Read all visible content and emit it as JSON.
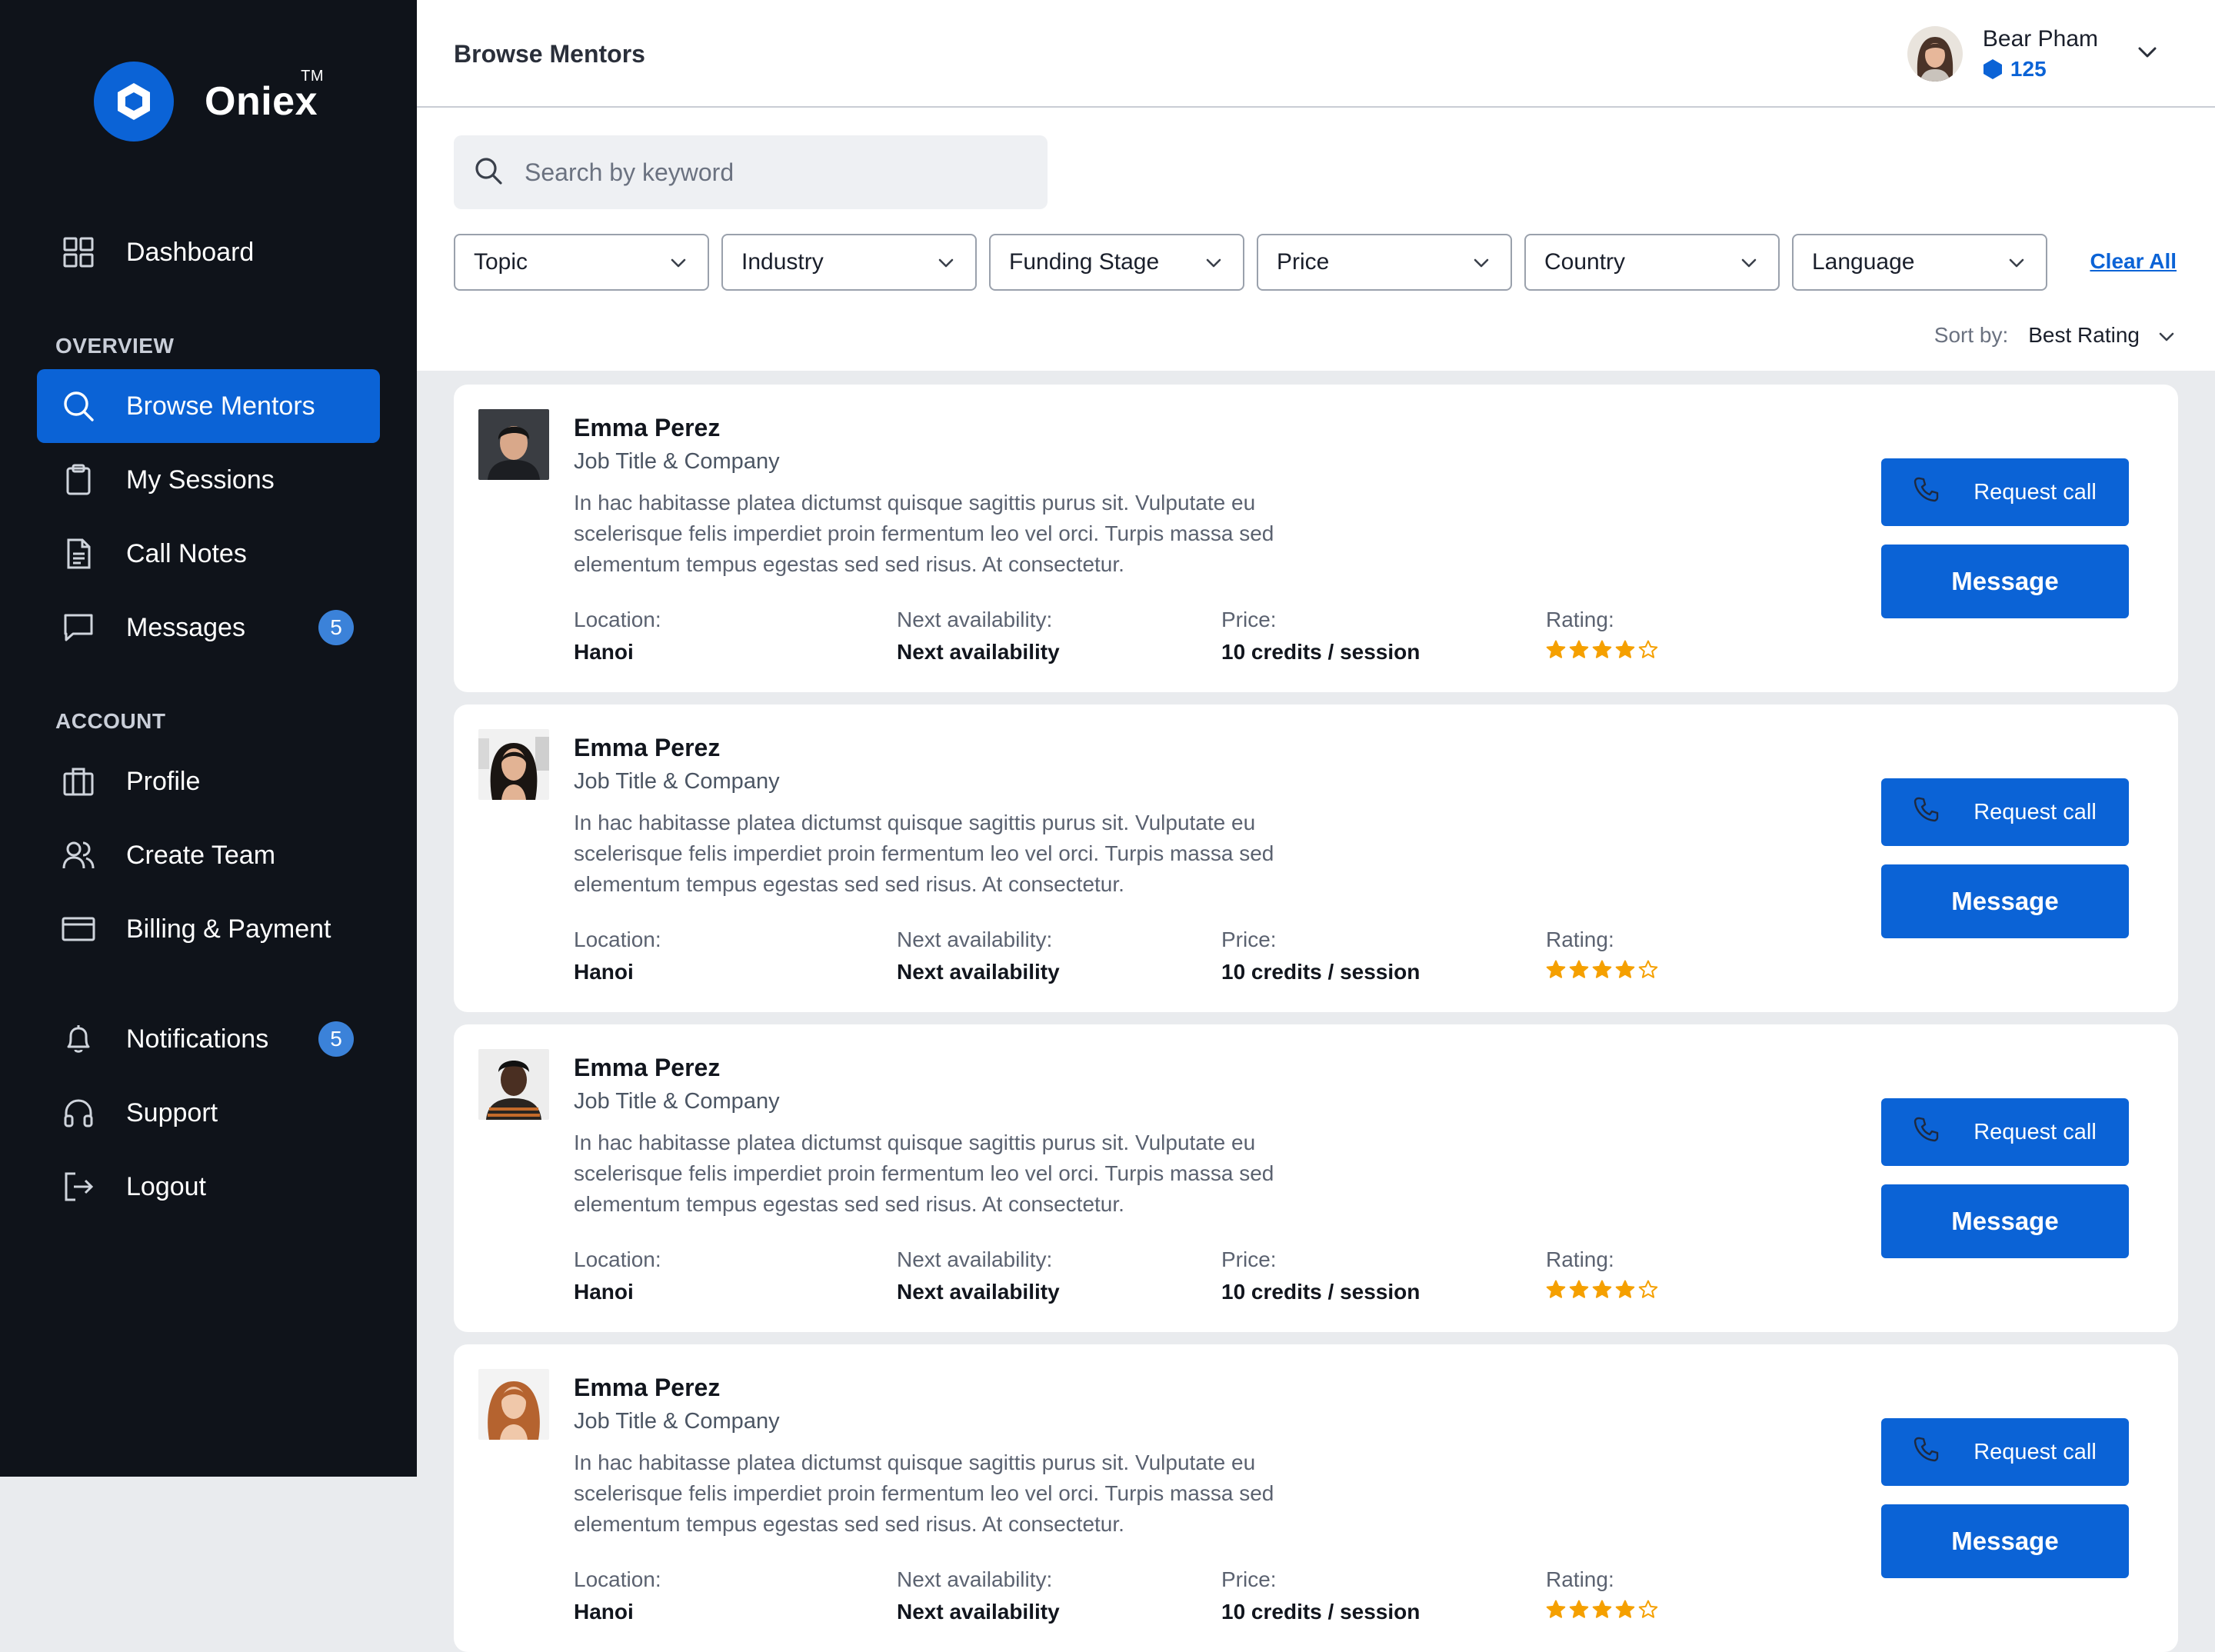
{
  "app": {
    "name": "Oniex",
    "tm": "TM"
  },
  "sidebar": {
    "dashboard": {
      "label": "Dashboard",
      "icon": "grid-icon"
    },
    "overview_title": "OVERVIEW",
    "overview": [
      {
        "label": "Browse Mentors",
        "icon": "search-icon",
        "active": true
      },
      {
        "label": "My Sessions",
        "icon": "clipboard-icon"
      },
      {
        "label": "Call Notes",
        "icon": "document-icon"
      },
      {
        "label": "Messages",
        "icon": "chat-icon",
        "badge": "5"
      }
    ],
    "account_title": "ACCOUNT",
    "account": [
      {
        "label": "Profile",
        "icon": "briefcase-icon"
      },
      {
        "label": "Create Team",
        "icon": "users-icon"
      },
      {
        "label": "Billing & Payment",
        "icon": "credit-card-icon"
      }
    ],
    "bottom": [
      {
        "label": "Notifications",
        "icon": "bell-icon",
        "badge": "5"
      },
      {
        "label": "Support",
        "icon": "headphones-icon"
      },
      {
        "label": "Logout",
        "icon": "logout-icon"
      }
    ]
  },
  "header": {
    "title": "Browse Mentors"
  },
  "user": {
    "name": "Bear Pham",
    "credits": "125"
  },
  "search": {
    "placeholder": "Search by keyword",
    "value": ""
  },
  "filters": [
    "Topic",
    "Industry",
    "Funding Stage",
    "Price",
    "Country",
    "Language"
  ],
  "clear_all": "Clear All",
  "sort": {
    "label": "Sort by:",
    "value": "Best Rating"
  },
  "labels": {
    "location": "Location:",
    "availability": "Next availability:",
    "price": "Price:",
    "rating": "Rating:",
    "request_call": "Request call",
    "message": "Message"
  },
  "mentors": [
    {
      "name": "Emma Perez",
      "role": "Job Title & Company",
      "description": "In hac habitasse platea dictumst quisque sagittis purus sit. Vulputate eu scelerisque felis imperdiet proin fermentum leo vel orci. Turpis massa sed elementum tempus egestas sed sed risus. At consectetur.",
      "location": "Hanoi",
      "availability": "Next availability",
      "price": "10 credits / session",
      "rating": 4
    },
    {
      "name": "Emma Perez",
      "role": "Job Title & Company",
      "description": "In hac habitasse platea dictumst quisque sagittis purus sit. Vulputate eu scelerisque felis imperdiet proin fermentum leo vel orci. Turpis massa sed elementum tempus egestas sed sed risus. At consectetur.",
      "location": "Hanoi",
      "availability": "Next availability",
      "price": "10 credits / session",
      "rating": 4
    },
    {
      "name": "Emma Perez",
      "role": "Job Title & Company",
      "description": "In hac habitasse platea dictumst quisque sagittis purus sit. Vulputate eu scelerisque felis imperdiet proin fermentum leo vel orci. Turpis massa sed elementum tempus egestas sed sed risus. At consectetur.",
      "location": "Hanoi",
      "availability": "Next availability",
      "price": "10 credits / session",
      "rating": 4
    },
    {
      "name": "Emma Perez",
      "role": "Job Title & Company",
      "description": "In hac habitasse platea dictumst quisque sagittis purus sit. Vulputate eu scelerisque felis imperdiet proin fermentum leo vel orci. Turpis massa sed elementum tempus egestas sed sed risus. At consectetur.",
      "location": "Hanoi",
      "availability": "Next availability",
      "price": "10 credits / session",
      "rating": 4
    }
  ],
  "colors": {
    "accent": "#0b63d6",
    "sidebar": "#0f131a",
    "star": "#f5a000",
    "badge": "#3b82d9"
  }
}
